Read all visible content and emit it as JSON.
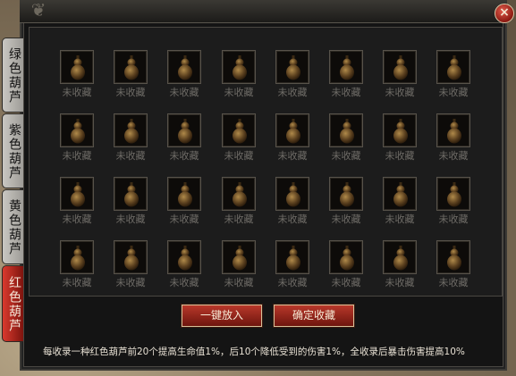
{
  "window": {
    "close_symbol": "×"
  },
  "tabs": [
    {
      "label": "绿色葫芦",
      "active": false
    },
    {
      "label": "紫色葫芦",
      "active": false
    },
    {
      "label": "黄色葫芦",
      "active": false
    },
    {
      "label": "红色葫芦",
      "active": true
    }
  ],
  "slots": {
    "rows": 4,
    "cols": 8,
    "status_label": "未收藏",
    "icon": "gourd-icon"
  },
  "buttons": {
    "one_click_label": "一键放入",
    "confirm_label": "确定收藏"
  },
  "info_text": "每收录一种红色葫芦前20个提高生命值1%，后10个降低受到的伤害1%，全收录后暴击伤害提高10%",
  "colors": {
    "active_tab": "#c0281e",
    "button": "#9a2a1e",
    "slot_label": "#6e6b66"
  }
}
